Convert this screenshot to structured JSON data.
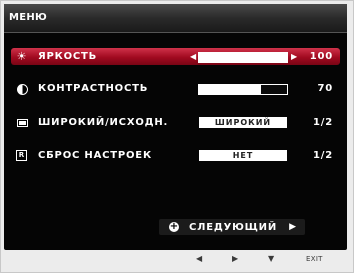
{
  "menu": {
    "title": "МЕНЮ"
  },
  "items": [
    {
      "icon": "brightness-icon",
      "label": "ЯРКОСТЬ",
      "value": "100",
      "level": 1.0,
      "selected": true
    },
    {
      "icon": "contrast-icon",
      "label": "КОНТРАСТНОСТЬ",
      "value": "70",
      "level": 0.7,
      "selected": false
    },
    {
      "icon": "aspect-ratio-icon",
      "label": "ШИРОКИЙ/ИСХОДН.",
      "option": "ШИРОКИЙ",
      "value": "1/2",
      "selected": false
    },
    {
      "icon": "reset-icon",
      "label": "СБРОС НАСТРОЕК",
      "option": "НЕТ",
      "value": "1/2",
      "selected": false
    }
  ],
  "next_button": {
    "label": "СЛЕДУЮЩИЙ"
  },
  "hardware_buttons": {
    "exit_label": "EXIT"
  },
  "colors": {
    "selection": "#a10a20",
    "background": "#050505",
    "text": "#ffffff"
  }
}
